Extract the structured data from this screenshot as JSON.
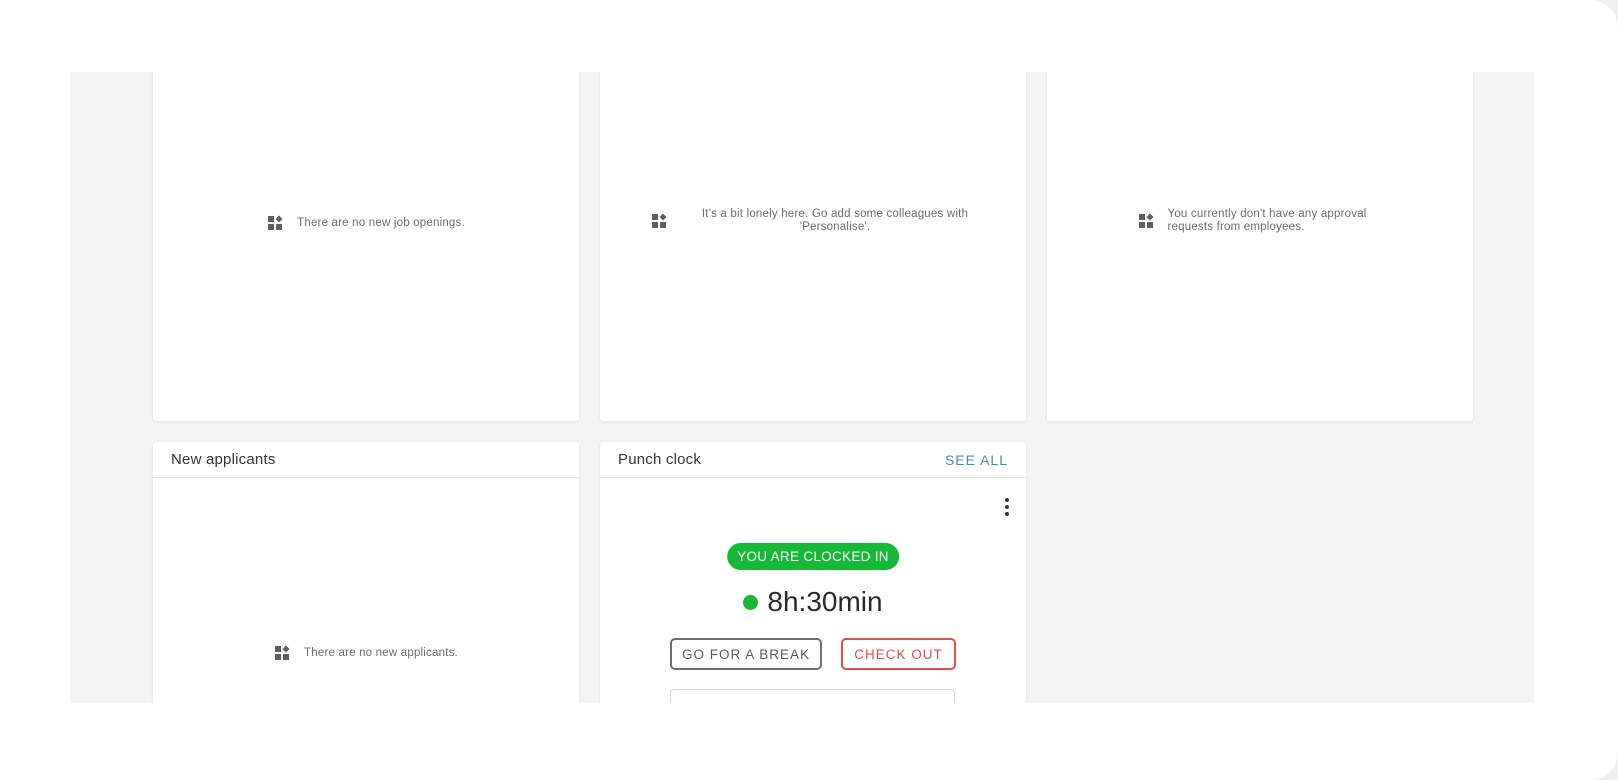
{
  "widgets": {
    "job_openings": {
      "empty_text": "There are no new job openings."
    },
    "colleagues": {
      "empty_text": "It's a bit lonely here. Go add some colleagues with 'Personalise'."
    },
    "approvals": {
      "empty_text": "You currently don't have any approval requests from employees."
    },
    "new_applicants": {
      "title": "New applicants",
      "empty_text": "There are no new applicants."
    },
    "punch_clock": {
      "title": "Punch clock",
      "see_all_label": "SEE ALL",
      "status": "YOU ARE CLOCKED IN",
      "elapsed": "8h:30min",
      "break_label": "GO FOR A BREAK",
      "checkout_label": "CHECK OUT"
    }
  },
  "icons": {
    "empty_state": "add-widget-icon",
    "menu": "more-vertical-icon",
    "status_dot": "green-dot-icon"
  },
  "colors": {
    "accent_blue": "#4a86c9",
    "clocked_in_green": "#15b935",
    "checkout_red": "#e84a4a"
  }
}
